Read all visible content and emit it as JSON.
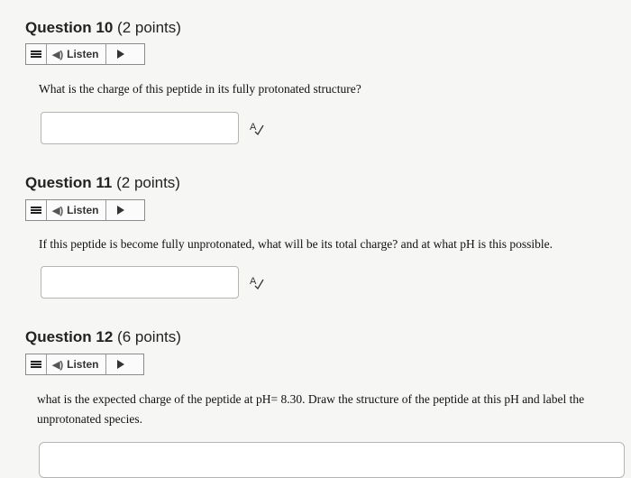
{
  "questions": [
    {
      "number": "Question 10",
      "points": "(2 points)",
      "listen_label": "Listen",
      "text": "What is the charge of this peptide in its fully protonated structure?"
    },
    {
      "number": "Question 11",
      "points": "(2 points)",
      "listen_label": "Listen",
      "text": "If this peptide is become fully unprotonated, what will be its total charge? and at what pH is this possible."
    },
    {
      "number": "Question 12",
      "points": "(6 points)",
      "listen_label": "Listen",
      "text": "what is the expected charge of the peptide at pH= 8.30. Draw the structure of the peptide at this pH and label the unprotonated species."
    }
  ],
  "icons": {
    "menu": "menu-icon",
    "speaker": "speaker-icon",
    "play": "play-icon",
    "spellcheck": "spellcheck-icon"
  }
}
